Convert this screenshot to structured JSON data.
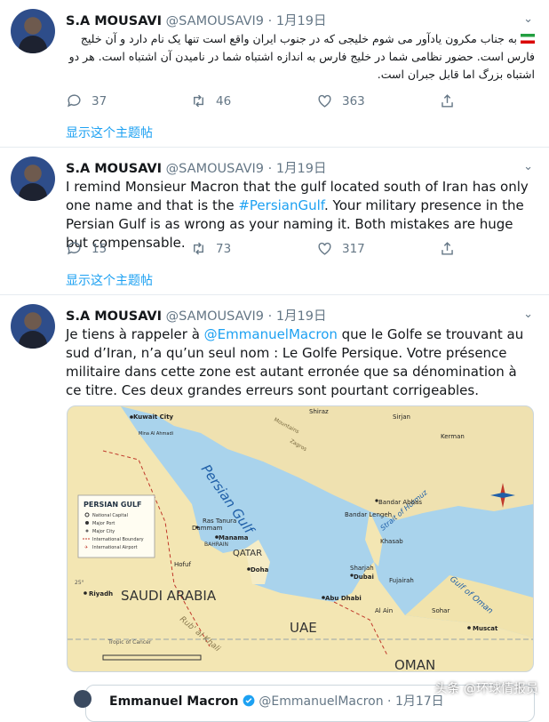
{
  "tweets": [
    {
      "name": "S.A MOUSAVI",
      "handle": "@SAMOUSAVI9",
      "sep": "·",
      "date": "1月19日",
      "text_rtl": "به جناب مکرون یادآور می شوم خلیجی که در جنوب ایران واقع است تنها یک نام دارد و آن خلیج فارس است. حضور نظامی شما در خلیج فارس به اندازه اشتباه شما در نامیدن آن اشتباه است. هر دو اشتباه بزرگ اما قابل جبران است.",
      "reply_count": "37",
      "retweet_count": "46",
      "like_count": "363",
      "thread_label": "显示这个主题帖"
    },
    {
      "name": "S.A MOUSAVI",
      "handle": "@SAMOUSAVI9",
      "sep": "·",
      "date": "1月19日",
      "text_before": "I remind Monsieur Macron that the gulf located south of Iran has only one name and that is the ",
      "hashtag": "#PersianGulf",
      "text_after": ". Your military presence in the Persian Gulf is as wrong as your naming it. Both mistakes are huge but compensable.",
      "reply_count": "15",
      "retweet_count": "73",
      "like_count": "317",
      "thread_label": "显示这个主题帖"
    },
    {
      "name": "S.A MOUSAVI",
      "handle": "@SAMOUSAVI9",
      "sep": "·",
      "date": "1月19日",
      "text_before": "Je tiens à rappeler à ",
      "mention": "@EmmanuelMacron",
      "text_after": " que le Golfe se trouvant au sud d’Iran, n’a qu’un seul nom : Le Golfe Persique. Votre présence militaire dans cette zone est autant erronée que sa dénomination à ce titre. Ces  deux grandes erreurs sont  pourtant corrigeables."
    }
  ],
  "map": {
    "legend_title": "PERSIAN GULF",
    "legend_items": [
      "National Capital",
      "Major Port",
      "Major City",
      "International Boundary",
      "International Airport"
    ],
    "water_labels": [
      "Persian Gulf",
      "Gulf of Oman",
      "Strait of Hormuz"
    ],
    "country_labels": [
      "SAUDI ARABIA",
      "QATAR",
      "BAHRAIN",
      "UAE",
      "OMAN"
    ],
    "places": [
      "Kuwait City",
      "Mina Al Ahmadi",
      "Shiraz",
      "Sirjan",
      "Kerman",
      "Bandar Lengeh",
      "Bandar Abbas",
      "Khasab",
      "Ras Tanura",
      "Dammam",
      "Manama",
      "Hofuf",
      "Doha",
      "Riyadh",
      "Sharjah",
      "Dubai",
      "Abu Dhabi",
      "Al Ain",
      "Fujairah",
      "Sohar",
      "Muscat",
      "Mountains",
      "Zagros",
      "Rub' al Khali",
      "Tropic of Cancer",
      "25°"
    ],
    "colors": {
      "water": "#a9d3ec",
      "land": "#f3e6b3",
      "iran": "#efe1b0",
      "boundary": "#c0392b"
    }
  },
  "quote": {
    "name": "Emmanuel Macron",
    "handle": "@EmmanuelMacron",
    "sep": "·",
    "date": "1月17日"
  },
  "watermark": "头条 @环球情报员"
}
